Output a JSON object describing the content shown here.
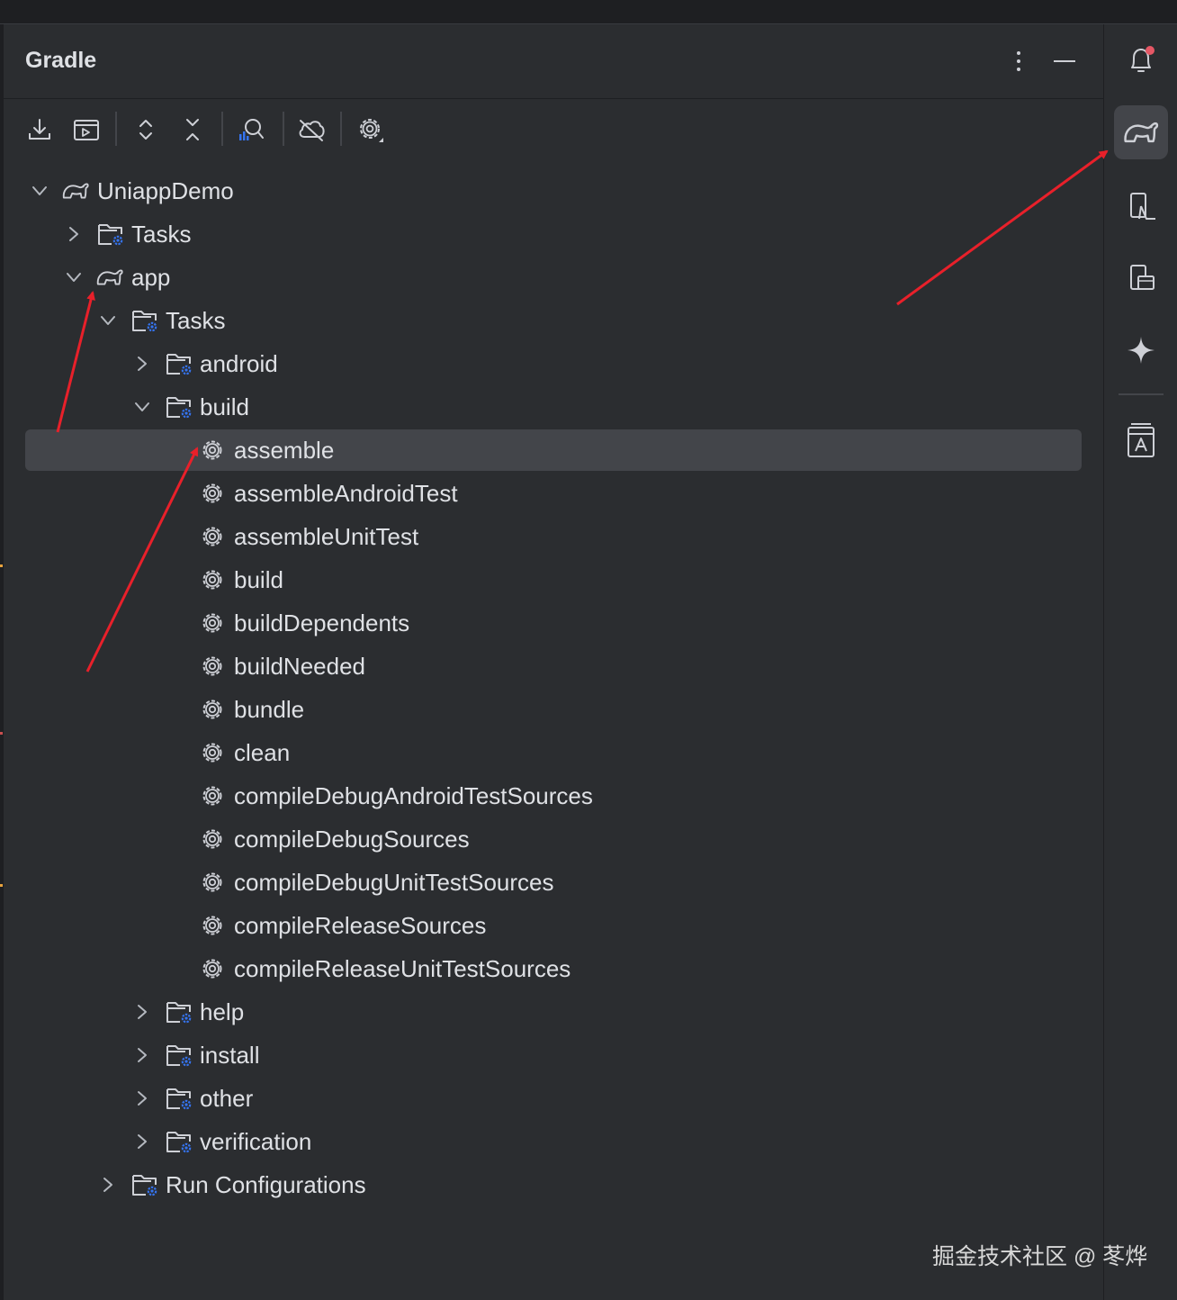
{
  "panel": {
    "title": "Gradle"
  },
  "toolbar": {
    "buttons": [
      "download-sources-icon",
      "run-task-icon",
      "expand-all-icon",
      "collapse-all-icon",
      "analyze-dependencies-icon",
      "offline-mode-icon",
      "settings-icon"
    ]
  },
  "tree": {
    "root": "UniappDemo",
    "root_tasks": "Tasks",
    "app": "app",
    "app_tasks": "Tasks",
    "groups": {
      "android": "android",
      "build": "build",
      "help": "help",
      "install": "install",
      "other": "other",
      "verification": "verification"
    },
    "build_tasks": [
      "assemble",
      "assembleAndroidTest",
      "assembleUnitTest",
      "build",
      "buildDependents",
      "buildNeeded",
      "bundle",
      "clean",
      "compileDebugAndroidTestSources",
      "compileDebugSources",
      "compileDebugUnitTestSources",
      "compileReleaseSources",
      "compileReleaseUnitTestSources"
    ],
    "selected_task": "assemble",
    "run_configurations": "Run Configurations"
  },
  "rightbar": {
    "items": [
      "notifications-icon",
      "gradle-icon",
      "device-manager-icon",
      "running-devices-icon",
      "gemini-icon",
      "resource-manager-icon"
    ],
    "active": "gradle-icon",
    "notification_dot_color": "#e55765"
  },
  "colors": {
    "annotation_arrow": "#e8202a",
    "task_badge": "#3574f0"
  },
  "watermark": "掘金技术社区 @ 苳烨"
}
